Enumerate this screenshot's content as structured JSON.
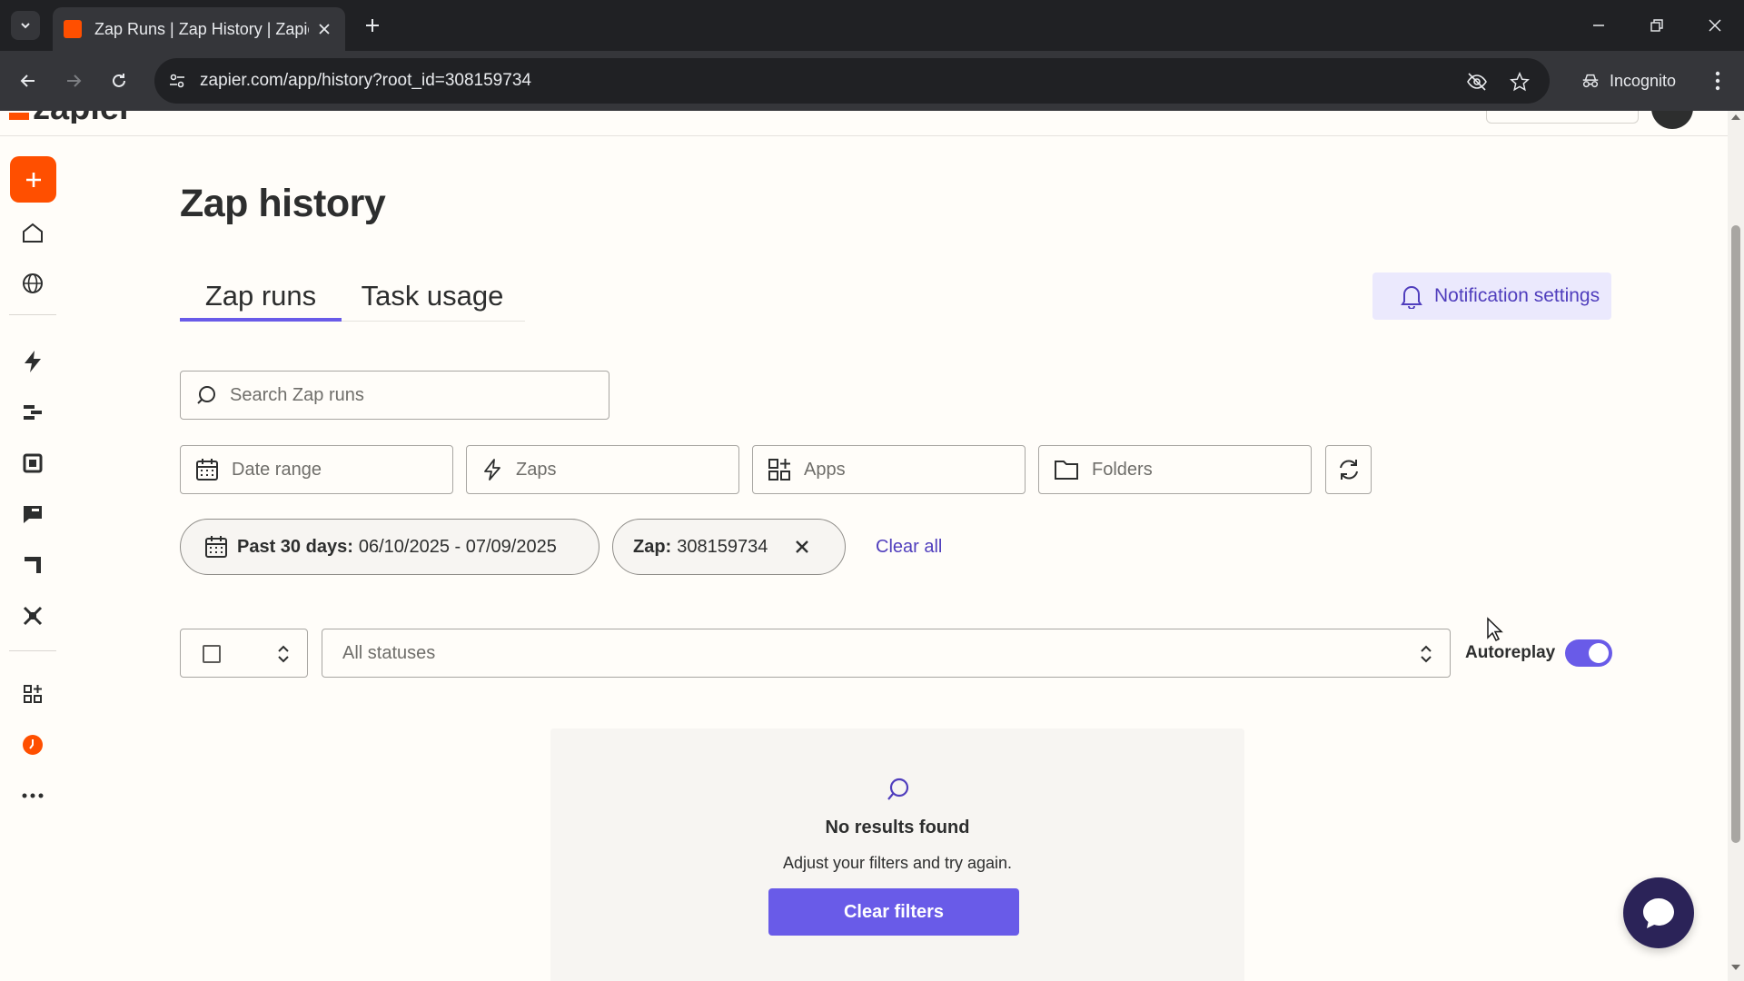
{
  "browser": {
    "tab_title": "Zap Runs | Zap History | Zapier",
    "url": "zapier.com/app/history?root_id=308159734",
    "incognito_label": "Incognito"
  },
  "header": {
    "logo_text": "zapier"
  },
  "page": {
    "title": "Zap history",
    "tabs": [
      {
        "label": "Zap runs",
        "active": true
      },
      {
        "label": "Task usage",
        "active": false
      }
    ],
    "notification_button": "Notification settings"
  },
  "search": {
    "placeholder": "Search Zap runs"
  },
  "filters": {
    "date_range": "Date range",
    "zaps": "Zaps",
    "apps": "Apps",
    "folders": "Folders"
  },
  "active_filters": {
    "date_label": "Past 30 days:",
    "date_value": "06/10/2025 - 07/09/2025",
    "zap_label": "Zap:",
    "zap_value": "308159734",
    "clear_all": "Clear all"
  },
  "status_filter": {
    "selected": "All statuses"
  },
  "autoplay": {
    "label": "Autoreplay",
    "enabled": true
  },
  "empty_state": {
    "title": "No results found",
    "subtitle": "Adjust your filters and try again.",
    "button": "Clear filters"
  },
  "colors": {
    "brand_orange": "#ff4f00",
    "accent_purple": "#695be8",
    "link_purple": "#503ebd",
    "chat_navy": "#2b2358"
  },
  "sidebar_icons": [
    "plus-icon",
    "home-icon",
    "globe-icon",
    "zap-icon",
    "tables-icon",
    "interfaces-icon",
    "chatbots-icon",
    "canvas-icon",
    "agents-icon",
    "apps-icon",
    "history-icon",
    "more-icon"
  ]
}
